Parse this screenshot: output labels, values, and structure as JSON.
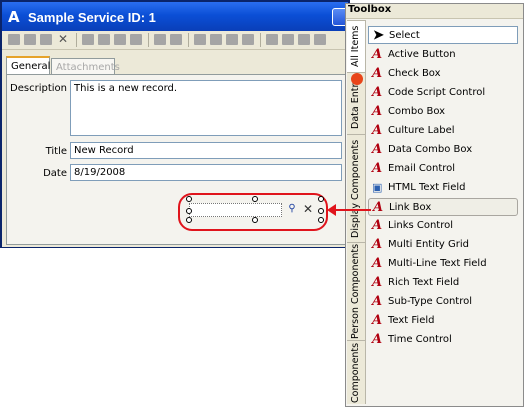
{
  "window": {
    "title": "Sample Service ID: 1",
    "app_icon": "A"
  },
  "tabs": [
    {
      "label": "General",
      "active": true
    },
    {
      "label": "Attachments",
      "active": false
    }
  ],
  "form": {
    "description_label": "Description",
    "description_value": "This is a new record.",
    "title_label": "Title",
    "title_value": "New Record",
    "date_label": "Date",
    "date_value": "8/19/2008"
  },
  "link_box": {
    "find_icon": "binoculars-icon",
    "clear_icon": "x-icon"
  },
  "toolbox": {
    "title": "Toolbox",
    "vertical_tabs": [
      "All Items",
      "Data Entry",
      "Display Components",
      "Person Components",
      "Components"
    ],
    "items": [
      {
        "label": "Select",
        "icon": "pointer-icon"
      },
      {
        "label": "Active Button",
        "icon": "component-icon"
      },
      {
        "label": "Check Box",
        "icon": "component-icon"
      },
      {
        "label": "Code Script Control",
        "icon": "component-icon"
      },
      {
        "label": "Combo Box",
        "icon": "component-icon"
      },
      {
        "label": "Culture Label",
        "icon": "component-icon"
      },
      {
        "label": "Data Combo Box",
        "icon": "component-icon"
      },
      {
        "label": "Email Control",
        "icon": "component-icon"
      },
      {
        "label": "HTML Text Field",
        "icon": "html-icon"
      },
      {
        "label": "Link Box",
        "icon": "component-icon"
      },
      {
        "label": "Links Control",
        "icon": "component-icon"
      },
      {
        "label": "Multi Entity Grid",
        "icon": "component-icon"
      },
      {
        "label": "Multi-Line Text Field",
        "icon": "component-icon"
      },
      {
        "label": "Rich Text Field",
        "icon": "component-icon"
      },
      {
        "label": "Sub-Type Control",
        "icon": "component-icon"
      },
      {
        "label": "Text Field",
        "icon": "component-icon"
      },
      {
        "label": "Time Control",
        "icon": "component-icon"
      }
    ]
  },
  "colors": {
    "title_bar": "#0b4fd6",
    "highlight": "#e0141c",
    "component_icon": "#b00010"
  }
}
